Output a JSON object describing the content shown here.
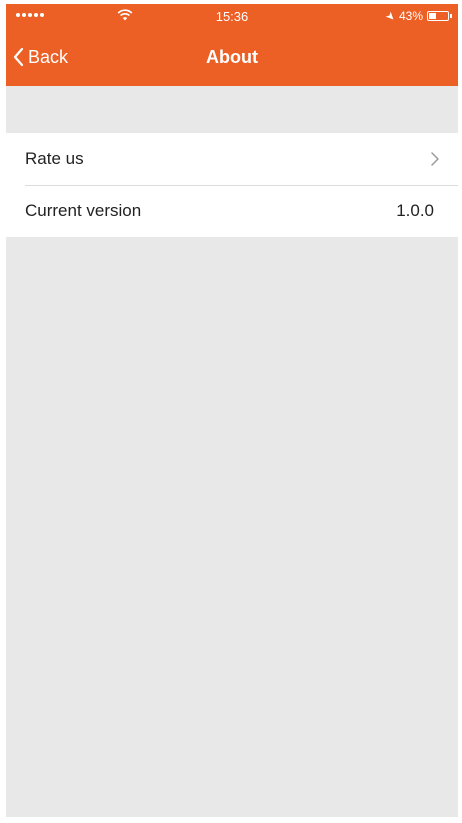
{
  "status_bar": {
    "time": "15:36",
    "battery_text": "43%",
    "battery_level": 0.43
  },
  "nav": {
    "back_label": "Back",
    "title": "About"
  },
  "list": {
    "items": [
      {
        "label": "Rate us",
        "value": "",
        "icon": "chevron-right-icon"
      },
      {
        "label": "Current version",
        "value": "1.0.0"
      }
    ]
  },
  "colors": {
    "header": "#ec5f25",
    "background": "#e8e8e8"
  }
}
